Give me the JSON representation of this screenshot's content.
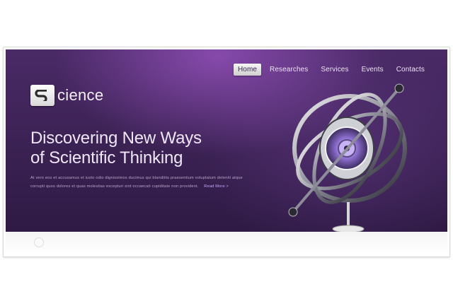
{
  "nav": {
    "items": [
      "Home",
      "Researches",
      "Services",
      "Events",
      "Contacts"
    ],
    "active": "Home"
  },
  "logo": {
    "text": "cience"
  },
  "hero": {
    "headline_line1": "Discovering New Ways",
    "headline_line2": "of Scientific Thinking",
    "body_text": "At vero eos et accusamus et iusto odio dignissimos ducimus qui blanditiis praesentium voluptatum deleniti atque corrupti quos dolores et quas molestias excepturi sint occaecati cupiditate non provident.",
    "read_more": "Read More >"
  },
  "colors": {
    "hero_bg": "#3d2356",
    "accent": "#c9a8ff",
    "nav_text": "#eae3f1"
  }
}
